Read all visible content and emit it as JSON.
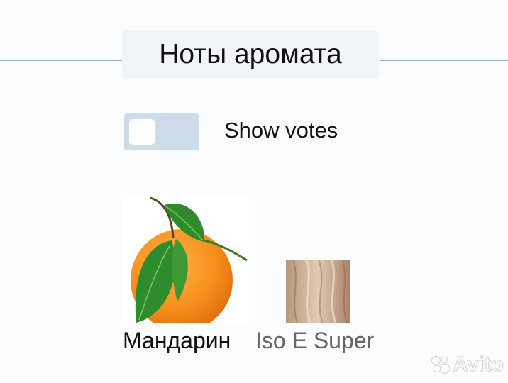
{
  "section": {
    "title": "Ноты аромата"
  },
  "votes_toggle": {
    "label": "Show votes",
    "state": "off"
  },
  "notes": [
    {
      "name": "Мандарин",
      "icon": "tangerine-image"
    },
    {
      "name": "Iso E Super",
      "icon": "iso-e-super-image"
    }
  ],
  "watermark": {
    "brand": "Avito"
  },
  "colors": {
    "divider": "#93aec0",
    "title_background": "#f1f5f9",
    "toggle_track": "#cddceb",
    "secondary_text": "#666666"
  }
}
